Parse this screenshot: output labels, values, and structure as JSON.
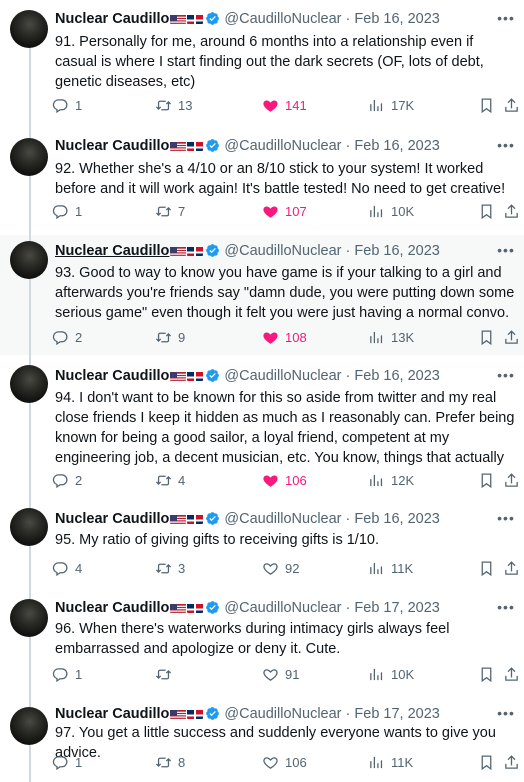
{
  "colors": {
    "text": "#0f1419",
    "secondary": "#536471",
    "liked": "#f91880",
    "verified": "#1d9bf0",
    "hover_bg": "#f7f9f9",
    "thread_line": "#cfd9de"
  },
  "icons": {
    "reply": "reply-icon",
    "retweet": "retweet-icon",
    "like": "heart-icon",
    "views": "views-icon",
    "bookmark": "bookmark-icon",
    "share": "share-icon",
    "more": "more-icon",
    "verified": "verified-badge-icon"
  },
  "tweets": [
    {
      "author": "Nuclear Caudillo",
      "handle": "@CaudilloNuclear",
      "separator": "·",
      "date": "Feb 16, 2023",
      "text": "91. Personally for me, around 6 months into a relationship even if casual is where I start finding out the dark secrets (OF, lots of debt, genetic diseases, etc)",
      "replies": "1",
      "retweets": "13",
      "likes": "141",
      "liked": true,
      "views": "17K"
    },
    {
      "author": "Nuclear Caudillo",
      "handle": "@CaudilloNuclear",
      "separator": "·",
      "date": "Feb 16, 2023",
      "text": "92. Whether she's a 4/10 or an 8/10 stick to your system! It worked before and it will work again! It's battle tested! No need to get creative!",
      "replies": "1",
      "retweets": "7",
      "likes": "107",
      "liked": true,
      "views": "10K"
    },
    {
      "author": "Nuclear Caudillo",
      "handle": "@CaudilloNuclear",
      "separator": "·",
      "date": "Feb 16, 2023",
      "text": "93. Good to way to know you have game is if your talking to a girl and afterwards you're friends say \"damn dude, you were putting down some serious game\" even though it felt you were just having a normal convo.",
      "replies": "2",
      "retweets": "9",
      "likes": "108",
      "liked": true,
      "views": "13K"
    },
    {
      "author": "Nuclear Caudillo",
      "handle": "@CaudilloNuclear",
      "separator": "·",
      "date": "Feb 16, 2023",
      "text": "94. I don't want to be known for this so aside from twitter and my real close friends I keep it hidden as much as I reasonably can. Prefer being known for being a good sailor, a loyal friend, competent at my engineering job, a decent musician, etc. You know, things that actually",
      "replies": "2",
      "retweets": "4",
      "likes": "106",
      "liked": true,
      "views": "12K"
    },
    {
      "author": "Nuclear Caudillo",
      "handle": "@CaudilloNuclear",
      "separator": "·",
      "date": "Feb 16, 2023",
      "text": "95. My ratio of giving gifts to receiving gifts is 1/10.",
      "replies": "4",
      "retweets": "3",
      "likes": "92",
      "liked": false,
      "views": "11K"
    },
    {
      "author": "Nuclear Caudillo",
      "handle": "@CaudilloNuclear",
      "separator": "·",
      "date": "Feb 17, 2023",
      "text": "96. When there's waterworks during intimacy girls always feel embarrassed and apologize or deny it. Cute.",
      "replies": "1",
      "retweets": "",
      "likes": "91",
      "liked": false,
      "views": "10K"
    },
    {
      "author": "Nuclear Caudillo",
      "handle": "@CaudilloNuclear",
      "separator": "·",
      "date": "Feb 17, 2023",
      "text": "97. You get a little success and suddenly everyone wants to give you advice.",
      "replies": "1",
      "retweets": "8",
      "likes": "106",
      "liked": false,
      "views": "11K"
    }
  ]
}
